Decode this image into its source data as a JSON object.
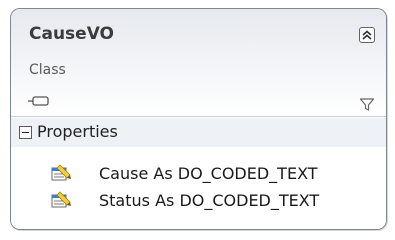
{
  "class": {
    "name": "CauseVO",
    "stereotype": "Class"
  },
  "compartments": [
    {
      "title": "Properties",
      "members": [
        {
          "text": "Cause As DO_CODED_TEXT",
          "icon": "property-icon"
        },
        {
          "text": "Status As DO_CODED_TEXT",
          "icon": "property-icon"
        }
      ]
    }
  ],
  "icons": {
    "collapse": "chevron-up-double-icon",
    "class_shape": "class-shape-icon",
    "filter": "filter-icon"
  },
  "colors": {
    "border": "#7d8791",
    "header_gradient_top": "#e6e9ee",
    "section_header_bg": "#eef1f5",
    "property_icon_yellow": "#f4d03f",
    "property_icon_blue": "#3d7bd9"
  }
}
